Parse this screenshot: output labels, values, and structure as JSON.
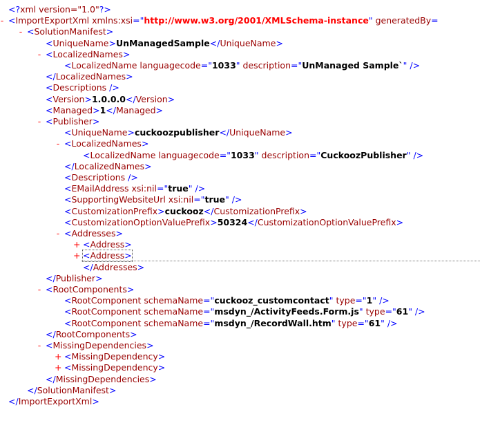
{
  "xml": {
    "lines": [
      {
        "tog": "",
        "ind": 12,
        "parts": [
          {
            "t": "<?",
            "c": "b"
          },
          {
            "t": "xml version=\"1.0\"",
            "c": "t"
          },
          {
            "t": "?>",
            "c": "b"
          }
        ]
      },
      {
        "tog": "-",
        "ind": 12,
        "parts": [
          {
            "t": "<",
            "c": "b"
          },
          {
            "t": "ImportExportXml",
            "c": "t"
          },
          {
            "t": " xmlns:xsi",
            "c": "a"
          },
          {
            "t": "=\"",
            "c": "b"
          },
          {
            "t": "http://www.w3.org/2001/XMLSchema-instance",
            "c": "vr"
          },
          {
            "t": "\"",
            "c": "b"
          },
          {
            "t": " generatedBy",
            "c": "a"
          },
          {
            "t": "=",
            "c": "b"
          }
        ]
      },
      {
        "tog": "-",
        "ind": 39,
        "parts": [
          {
            "t": "<",
            "c": "b"
          },
          {
            "t": "SolutionManifest",
            "c": "t"
          },
          {
            "t": ">",
            "c": "b"
          }
        ]
      },
      {
        "tog": "",
        "ind": 66,
        "parts": [
          {
            "t": "<",
            "c": "b"
          },
          {
            "t": "UniqueName",
            "c": "t"
          },
          {
            "t": ">",
            "c": "b"
          },
          {
            "t": "UnManagedSample",
            "c": "v"
          },
          {
            "t": "</",
            "c": "b"
          },
          {
            "t": "UniqueName",
            "c": "t"
          },
          {
            "t": ">",
            "c": "b"
          }
        ]
      },
      {
        "tog": "-",
        "ind": 66,
        "parts": [
          {
            "t": "<",
            "c": "b"
          },
          {
            "t": "LocalizedNames",
            "c": "t"
          },
          {
            "t": ">",
            "c": "b"
          }
        ]
      },
      {
        "tog": "",
        "ind": 93,
        "parts": [
          {
            "t": "<",
            "c": "b"
          },
          {
            "t": "LocalizedName",
            "c": "t"
          },
          {
            "t": " languagecode",
            "c": "a"
          },
          {
            "t": "=\"",
            "c": "b"
          },
          {
            "t": "1033",
            "c": "v"
          },
          {
            "t": "\"",
            "c": "b"
          },
          {
            "t": " description",
            "c": "a"
          },
          {
            "t": "=\"",
            "c": "b"
          },
          {
            "t": "UnManaged Sample`",
            "c": "v"
          },
          {
            "t": "\" />",
            "c": "b"
          }
        ]
      },
      {
        "tog": "",
        "ind": 66,
        "parts": [
          {
            "t": "</",
            "c": "b"
          },
          {
            "t": "LocalizedNames",
            "c": "t"
          },
          {
            "t": ">",
            "c": "b"
          }
        ]
      },
      {
        "tog": "",
        "ind": 66,
        "parts": [
          {
            "t": "<",
            "c": "b"
          },
          {
            "t": "Descriptions",
            "c": "t"
          },
          {
            "t": " />",
            "c": "b"
          }
        ]
      },
      {
        "tog": "",
        "ind": 66,
        "parts": [
          {
            "t": "<",
            "c": "b"
          },
          {
            "t": "Version",
            "c": "t"
          },
          {
            "t": ">",
            "c": "b"
          },
          {
            "t": "1.0.0.0",
            "c": "v"
          },
          {
            "t": "</",
            "c": "b"
          },
          {
            "t": "Version",
            "c": "t"
          },
          {
            "t": ">",
            "c": "b"
          }
        ]
      },
      {
        "tog": "",
        "ind": 66,
        "parts": [
          {
            "t": "<",
            "c": "b"
          },
          {
            "t": "Managed",
            "c": "t"
          },
          {
            "t": ">",
            "c": "b"
          },
          {
            "t": "1",
            "c": "v"
          },
          {
            "t": "</",
            "c": "b"
          },
          {
            "t": "Managed",
            "c": "t"
          },
          {
            "t": ">",
            "c": "b"
          }
        ]
      },
      {
        "tog": "-",
        "ind": 66,
        "parts": [
          {
            "t": "<",
            "c": "b"
          },
          {
            "t": "Publisher",
            "c": "t"
          },
          {
            "t": ">",
            "c": "b"
          }
        ]
      },
      {
        "tog": "",
        "ind": 93,
        "parts": [
          {
            "t": "<",
            "c": "b"
          },
          {
            "t": "UniqueName",
            "c": "t"
          },
          {
            "t": ">",
            "c": "b"
          },
          {
            "t": "cuckoozpublisher",
            "c": "v"
          },
          {
            "t": "</",
            "c": "b"
          },
          {
            "t": "UniqueName",
            "c": "t"
          },
          {
            "t": ">",
            "c": "b"
          }
        ]
      },
      {
        "tog": "-",
        "ind": 93,
        "parts": [
          {
            "t": "<",
            "c": "b"
          },
          {
            "t": "LocalizedNames",
            "c": "t"
          },
          {
            "t": ">",
            "c": "b"
          }
        ]
      },
      {
        "tog": "",
        "ind": 120,
        "parts": [
          {
            "t": "<",
            "c": "b"
          },
          {
            "t": "LocalizedName",
            "c": "t"
          },
          {
            "t": " languagecode",
            "c": "a"
          },
          {
            "t": "=\"",
            "c": "b"
          },
          {
            "t": "1033",
            "c": "v"
          },
          {
            "t": "\"",
            "c": "b"
          },
          {
            "t": " description",
            "c": "a"
          },
          {
            "t": "=\"",
            "c": "b"
          },
          {
            "t": "CuckoozPublisher",
            "c": "v"
          },
          {
            "t": "\" />",
            "c": "b"
          }
        ]
      },
      {
        "tog": "",
        "ind": 93,
        "parts": [
          {
            "t": "</",
            "c": "b"
          },
          {
            "t": "LocalizedNames",
            "c": "t"
          },
          {
            "t": ">",
            "c": "b"
          }
        ]
      },
      {
        "tog": "",
        "ind": 93,
        "parts": [
          {
            "t": "<",
            "c": "b"
          },
          {
            "t": "Descriptions",
            "c": "t"
          },
          {
            "t": " />",
            "c": "b"
          }
        ]
      },
      {
        "tog": "",
        "ind": 93,
        "parts": [
          {
            "t": "<",
            "c": "b"
          },
          {
            "t": "EMailAddress",
            "c": "t"
          },
          {
            "t": " xsi:nil",
            "c": "a"
          },
          {
            "t": "=\"",
            "c": "b"
          },
          {
            "t": "true",
            "c": "v"
          },
          {
            "t": "\" />",
            "c": "b"
          }
        ]
      },
      {
        "tog": "",
        "ind": 93,
        "parts": [
          {
            "t": "<",
            "c": "b"
          },
          {
            "t": "SupportingWebsiteUrl",
            "c": "t"
          },
          {
            "t": " xsi:nil",
            "c": "a"
          },
          {
            "t": "=\"",
            "c": "b"
          },
          {
            "t": "true",
            "c": "v"
          },
          {
            "t": "\" />",
            "c": "b"
          }
        ]
      },
      {
        "tog": "",
        "ind": 93,
        "parts": [
          {
            "t": "<",
            "c": "b"
          },
          {
            "t": "CustomizationPrefix",
            "c": "t"
          },
          {
            "t": ">",
            "c": "b"
          },
          {
            "t": "cuckooz",
            "c": "v"
          },
          {
            "t": "</",
            "c": "b"
          },
          {
            "t": "CustomizationPrefix",
            "c": "t"
          },
          {
            "t": ">",
            "c": "b"
          }
        ]
      },
      {
        "tog": "",
        "ind": 93,
        "parts": [
          {
            "t": "<",
            "c": "b"
          },
          {
            "t": "CustomizationOptionValuePrefix",
            "c": "t"
          },
          {
            "t": ">",
            "c": "b"
          },
          {
            "t": "50324",
            "c": "v"
          },
          {
            "t": "</",
            "c": "b"
          },
          {
            "t": "CustomizationOptionValuePrefix",
            "c": "t"
          },
          {
            "t": ">",
            "c": "b"
          }
        ]
      },
      {
        "tog": "-",
        "ind": 93,
        "parts": [
          {
            "t": "<",
            "c": "b"
          },
          {
            "t": "Addresses",
            "c": "t"
          },
          {
            "t": ">",
            "c": "b"
          }
        ]
      },
      {
        "tog": "+",
        "ind": 120,
        "parts": [
          {
            "t": "<",
            "c": "b"
          },
          {
            "t": "Address",
            "c": "t"
          },
          {
            "t": ">",
            "c": "b"
          }
        ]
      },
      {
        "tog": "+",
        "ind": 120,
        "sel": true,
        "parts": [
          {
            "t": "<",
            "c": "b"
          },
          {
            "t": "Address",
            "c": "t"
          },
          {
            "t": ">",
            "c": "b"
          }
        ]
      },
      {
        "tog": "",
        "ind": 120,
        "parts": [
          {
            "t": "</",
            "c": "b"
          },
          {
            "t": "Addresses",
            "c": "t"
          },
          {
            "t": ">",
            "c": "b"
          }
        ]
      },
      {
        "tog": "",
        "ind": 66,
        "parts": [
          {
            "t": "</",
            "c": "b"
          },
          {
            "t": "Publisher",
            "c": "t"
          },
          {
            "t": ">",
            "c": "b"
          }
        ]
      },
      {
        "tog": "-",
        "ind": 66,
        "parts": [
          {
            "t": "<",
            "c": "b"
          },
          {
            "t": "RootComponents",
            "c": "t"
          },
          {
            "t": ">",
            "c": "b"
          }
        ]
      },
      {
        "tog": "",
        "ind": 93,
        "parts": [
          {
            "t": "<",
            "c": "b"
          },
          {
            "t": "RootComponent",
            "c": "t"
          },
          {
            "t": " schemaName",
            "c": "a"
          },
          {
            "t": "=\"",
            "c": "b"
          },
          {
            "t": "cuckooz_customcontact",
            "c": "v"
          },
          {
            "t": "\"",
            "c": "b"
          },
          {
            "t": " type",
            "c": "a"
          },
          {
            "t": "=\"",
            "c": "b"
          },
          {
            "t": "1",
            "c": "v"
          },
          {
            "t": "\" />",
            "c": "b"
          }
        ]
      },
      {
        "tog": "",
        "ind": 93,
        "parts": [
          {
            "t": "<",
            "c": "b"
          },
          {
            "t": "RootComponent",
            "c": "t"
          },
          {
            "t": " schemaName",
            "c": "a"
          },
          {
            "t": "=\"",
            "c": "b"
          },
          {
            "t": "msdyn_/ActivityFeeds.Form.js",
            "c": "v"
          },
          {
            "t": "\"",
            "c": "b"
          },
          {
            "t": " type",
            "c": "a"
          },
          {
            "t": "=\"",
            "c": "b"
          },
          {
            "t": "61",
            "c": "v"
          },
          {
            "t": "\" />",
            "c": "b"
          }
        ]
      },
      {
        "tog": "",
        "ind": 93,
        "parts": [
          {
            "t": "<",
            "c": "b"
          },
          {
            "t": "RootComponent",
            "c": "t"
          },
          {
            "t": " schemaName",
            "c": "a"
          },
          {
            "t": "=\"",
            "c": "b"
          },
          {
            "t": "msdyn_/RecordWall.htm",
            "c": "v"
          },
          {
            "t": "\"",
            "c": "b"
          },
          {
            "t": " type",
            "c": "a"
          },
          {
            "t": "=\"",
            "c": "b"
          },
          {
            "t": "61",
            "c": "v"
          },
          {
            "t": "\" />",
            "c": "b"
          }
        ]
      },
      {
        "tog": "",
        "ind": 66,
        "parts": [
          {
            "t": "</",
            "c": "b"
          },
          {
            "t": "RootComponents",
            "c": "t"
          },
          {
            "t": ">",
            "c": "b"
          }
        ]
      },
      {
        "tog": "-",
        "ind": 66,
        "parts": [
          {
            "t": "<",
            "c": "b"
          },
          {
            "t": "MissingDependencies",
            "c": "t"
          },
          {
            "t": ">",
            "c": "b"
          }
        ]
      },
      {
        "tog": "+",
        "ind": 93,
        "parts": [
          {
            "t": "<",
            "c": "b"
          },
          {
            "t": "MissingDependency",
            "c": "t"
          },
          {
            "t": ">",
            "c": "b"
          }
        ]
      },
      {
        "tog": "+",
        "ind": 93,
        "parts": [
          {
            "t": "<",
            "c": "b"
          },
          {
            "t": "MissingDependency",
            "c": "t"
          },
          {
            "t": ">",
            "c": "b"
          }
        ]
      },
      {
        "tog": "",
        "ind": 66,
        "parts": [
          {
            "t": "</",
            "c": "b"
          },
          {
            "t": "MissingDependencies",
            "c": "t"
          },
          {
            "t": ">",
            "c": "b"
          }
        ]
      },
      {
        "tog": "",
        "ind": 39,
        "parts": [
          {
            "t": "</",
            "c": "b"
          },
          {
            "t": "SolutionManifest",
            "c": "t"
          },
          {
            "t": ">",
            "c": "b"
          }
        ]
      },
      {
        "tog": "",
        "ind": 12,
        "parts": [
          {
            "t": "</",
            "c": "b"
          },
          {
            "t": "ImportExportXml",
            "c": "t"
          },
          {
            "t": ">",
            "c": "b"
          }
        ]
      }
    ]
  }
}
